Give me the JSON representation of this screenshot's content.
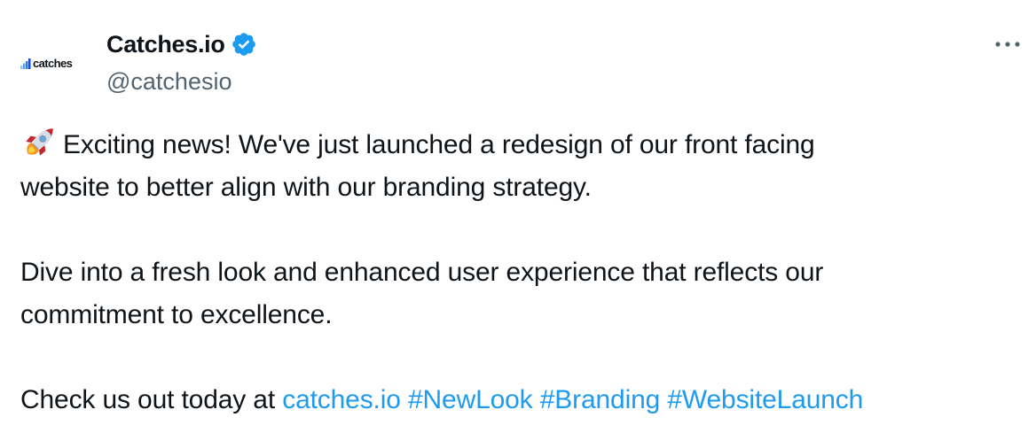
{
  "author": {
    "avatar_text": "catches",
    "display_name": "Catches.io",
    "handle": "@catchesio",
    "verified": true,
    "avatar_icon": "catches-logo-icon",
    "verified_icon": "verified-badge-icon"
  },
  "more_icon": "ellipsis-icon",
  "body": {
    "emoji_icon": "rocket-icon",
    "p1_line1": "Exciting news! We've just launched a redesign of our front facing",
    "p1_line2": "website to better align with our branding strategy.",
    "p2_line1": "Dive into a fresh look and enhanced user experience that reflects our",
    "p2_line2": "commitment to excellence.",
    "p3_prefix": "Check us out today at ",
    "link": "catches.io",
    "hashtags": [
      "#NewLook",
      "#Branding",
      "#WebsiteLaunch"
    ]
  },
  "colors": {
    "link": "#1d9bf0",
    "secondary_text": "#536471",
    "primary_text": "#0f1419",
    "verified": "#1d9bf0"
  }
}
